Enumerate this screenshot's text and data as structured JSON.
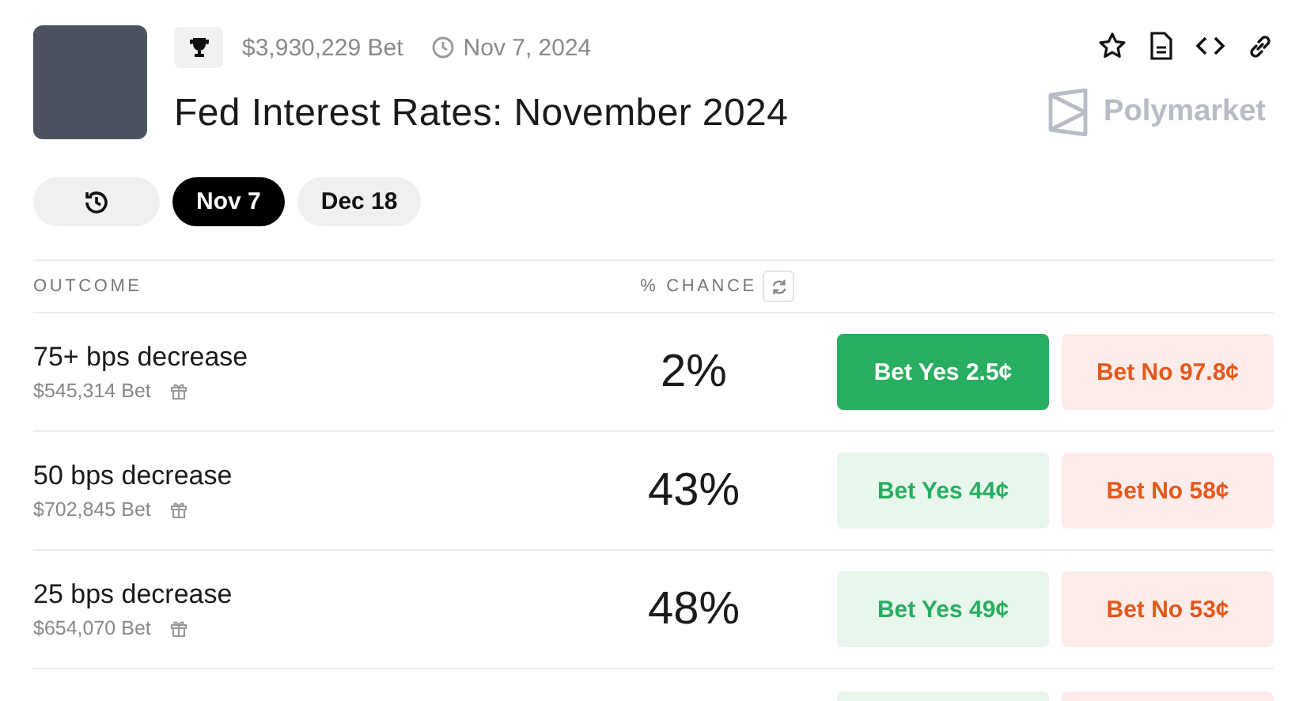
{
  "header": {
    "volume": "$3,930,229 Bet",
    "date": "Nov 7, 2024",
    "title": "Fed Interest Rates: November 2024",
    "brand": "Polymarket"
  },
  "tabs": [
    {
      "label": "Nov 7",
      "selected": true
    },
    {
      "label": "Dec 18",
      "selected": false
    }
  ],
  "table": {
    "columns": [
      "OUTCOME",
      "% CHANCE"
    ],
    "rows": [
      {
        "outcome": "75+ bps decrease",
        "volume": "$545,314 Bet",
        "chance": "2%",
        "yes": "Bet Yes 2.5¢",
        "no": "Bet No 97.8¢",
        "selected": true
      },
      {
        "outcome": "50 bps decrease",
        "volume": "$702,845 Bet",
        "chance": "43%",
        "yes": "Bet Yes 44¢",
        "no": "Bet No 58¢",
        "selected": false
      },
      {
        "outcome": "25 bps decrease",
        "volume": "$654,070 Bet",
        "chance": "48%",
        "yes": "Bet Yes 49¢",
        "no": "Bet No 53¢",
        "selected": false
      },
      {
        "selected": false
      }
    ]
  }
}
